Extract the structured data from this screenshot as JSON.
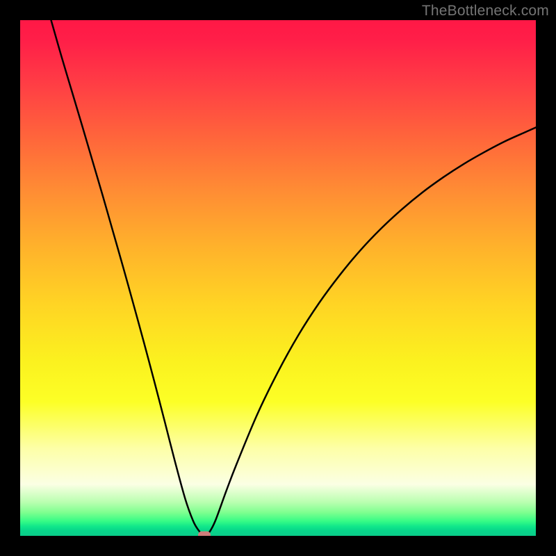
{
  "watermark": "TheBottleneck.com",
  "chart_data": {
    "type": "line",
    "title": "",
    "xlabel": "",
    "ylabel": "",
    "xlim": [
      0,
      100
    ],
    "ylim": [
      0,
      100
    ],
    "grid": false,
    "series": [
      {
        "name": "bottleneck-curve",
        "x": [
          6,
          8,
          10,
          12,
          14,
          16,
          18,
          20,
          22,
          24,
          26,
          28,
          30,
          32,
          33.5,
          34.5,
          35.3,
          35.8,
          36.3,
          37,
          38,
          40,
          42,
          46,
          50,
          54,
          58,
          62,
          66,
          70,
          74,
          78,
          82,
          86,
          90,
          94,
          98,
          100
        ],
        "y": [
          100,
          93,
          86.3,
          79.6,
          72.8,
          66,
          59,
          52,
          44.8,
          37.5,
          30,
          22.3,
          14.5,
          7.2,
          3,
          1.2,
          0.3,
          0.15,
          0.3,
          1.2,
          3.3,
          8.8,
          14,
          23.6,
          31.8,
          39,
          45.2,
          50.6,
          55.4,
          59.6,
          63.3,
          66.6,
          69.5,
          72.1,
          74.4,
          76.5,
          78.3,
          79.2
        ]
      }
    ],
    "marker": {
      "x": 35.7,
      "y": 0.1,
      "color": "#cf7d7b"
    },
    "background_gradient": {
      "top": "#ff1846",
      "mid": "#ffd424",
      "bottom": "#0acc89"
    }
  }
}
